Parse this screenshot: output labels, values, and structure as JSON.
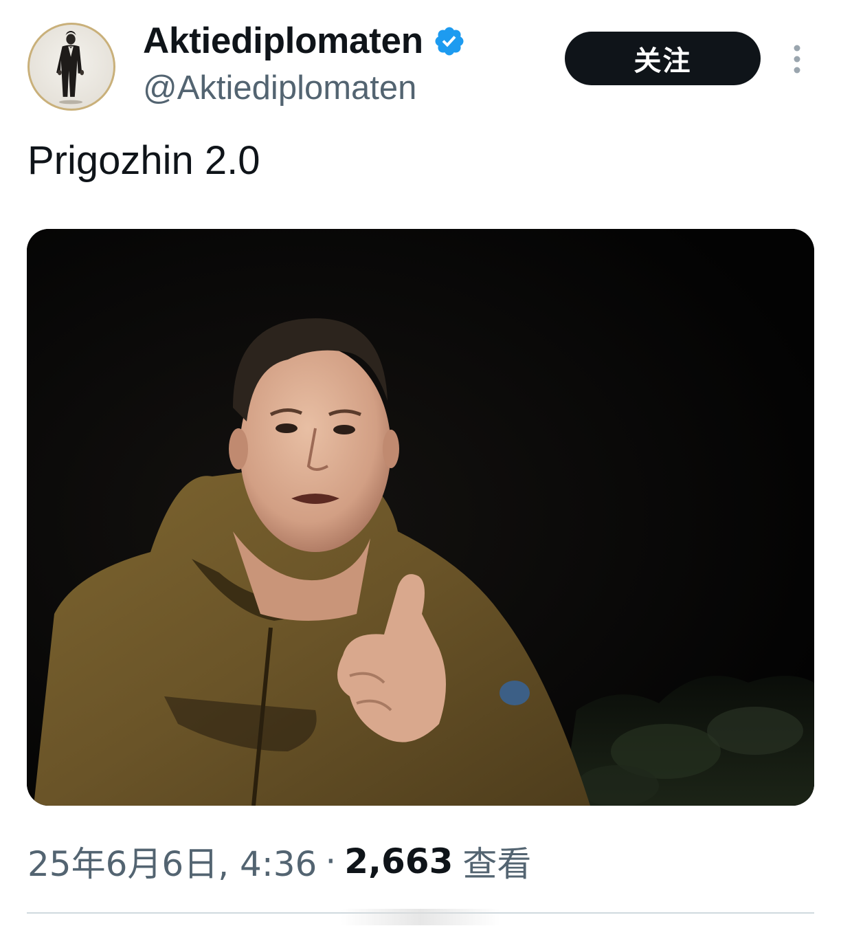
{
  "tweet": {
    "author": {
      "display_name": "Aktiediplomaten",
      "handle": "@Aktiediplomaten",
      "verified": true,
      "avatar_icon": "avatar-man-in-tuxedo"
    },
    "follow_label": "关注",
    "more_icon": "more-vertical-icon",
    "text": "Prigozhin 2.0",
    "media": {
      "kind": "photo"
    },
    "timestamp": "25年6月6日, 4:36",
    "separator": "·",
    "views_count": "2,663",
    "views_label": "查看"
  },
  "colors": {
    "text_primary": "#0f1419",
    "text_secondary": "#536471",
    "verified_blue": "#1d9bf0",
    "button_bg": "#0f1419",
    "divider": "#cfd9de"
  }
}
